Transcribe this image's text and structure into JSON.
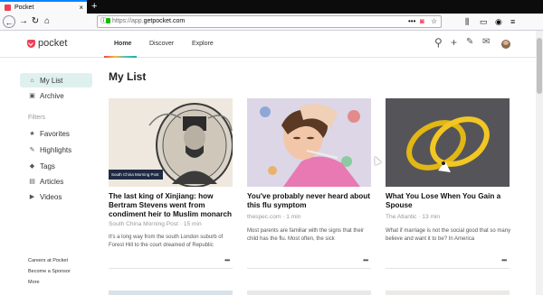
{
  "browser": {
    "tab_title": "Pocket",
    "tab_close": "×",
    "new_tab": "+",
    "url_prefix": "https://app.",
    "url_host": "getpocket.com",
    "url_dots": "•••",
    "icons": [
      "back-icon",
      "forward-icon",
      "reload-icon",
      "home-icon",
      "info-icon",
      "lock-icon",
      "pocket-save-icon",
      "bookmark-star-icon",
      "library-icon",
      "sidebar-icon",
      "account-icon",
      "menu-icon"
    ]
  },
  "header": {
    "logo_text": "pocket",
    "nav": [
      "Home",
      "Discover",
      "Explore"
    ],
    "icons": [
      "search-icon",
      "add-icon",
      "highlight-icon",
      "mail-icon",
      "avatar"
    ]
  },
  "sidebar": {
    "items": [
      {
        "label": "My List",
        "icon": "home-icon"
      },
      {
        "label": "Archive",
        "icon": "archive-icon"
      }
    ],
    "filters_heading": "Filters",
    "filters": [
      {
        "label": "Favorites",
        "icon": "star-icon"
      },
      {
        "label": "Highlights",
        "icon": "highlighter-icon"
      },
      {
        "label": "Tags",
        "icon": "tag-icon"
      },
      {
        "label": "Articles",
        "icon": "article-icon"
      },
      {
        "label": "Videos",
        "icon": "video-icon"
      }
    ],
    "footer": [
      "Careers at Pocket",
      "Become a Sponsor",
      "More"
    ]
  },
  "main": {
    "heading": "My List",
    "cards": [
      {
        "title": "The last king of Xinjiang: how Bertram Stevens went from condiment heir to Muslim monarch",
        "source": "South China Morning Post · 15 min",
        "excerpt": "It's a long way from the south London suburb of Forest Hill to the court dreamed of Republic",
        "badge": "South China Morning Post",
        "more": "•••"
      },
      {
        "title": "You've probably never heard about this flu symptom",
        "source": "thespec.com · 1 min",
        "excerpt": "Most parents are familiar with the signs that their child has the flu. Most often, the sick",
        "more": "•••"
      },
      {
        "title": "What You Lose When You Gain a Spouse",
        "source": "The Atlantic · 13 min",
        "excerpt": "What if marriage is not the social good that so many believe and want it to be? In America",
        "more": "•••"
      }
    ]
  },
  "colors": {
    "accent": "#ef4056",
    "active_bg": "#dff1ee",
    "chrome_dark": "#0c0c0d"
  }
}
